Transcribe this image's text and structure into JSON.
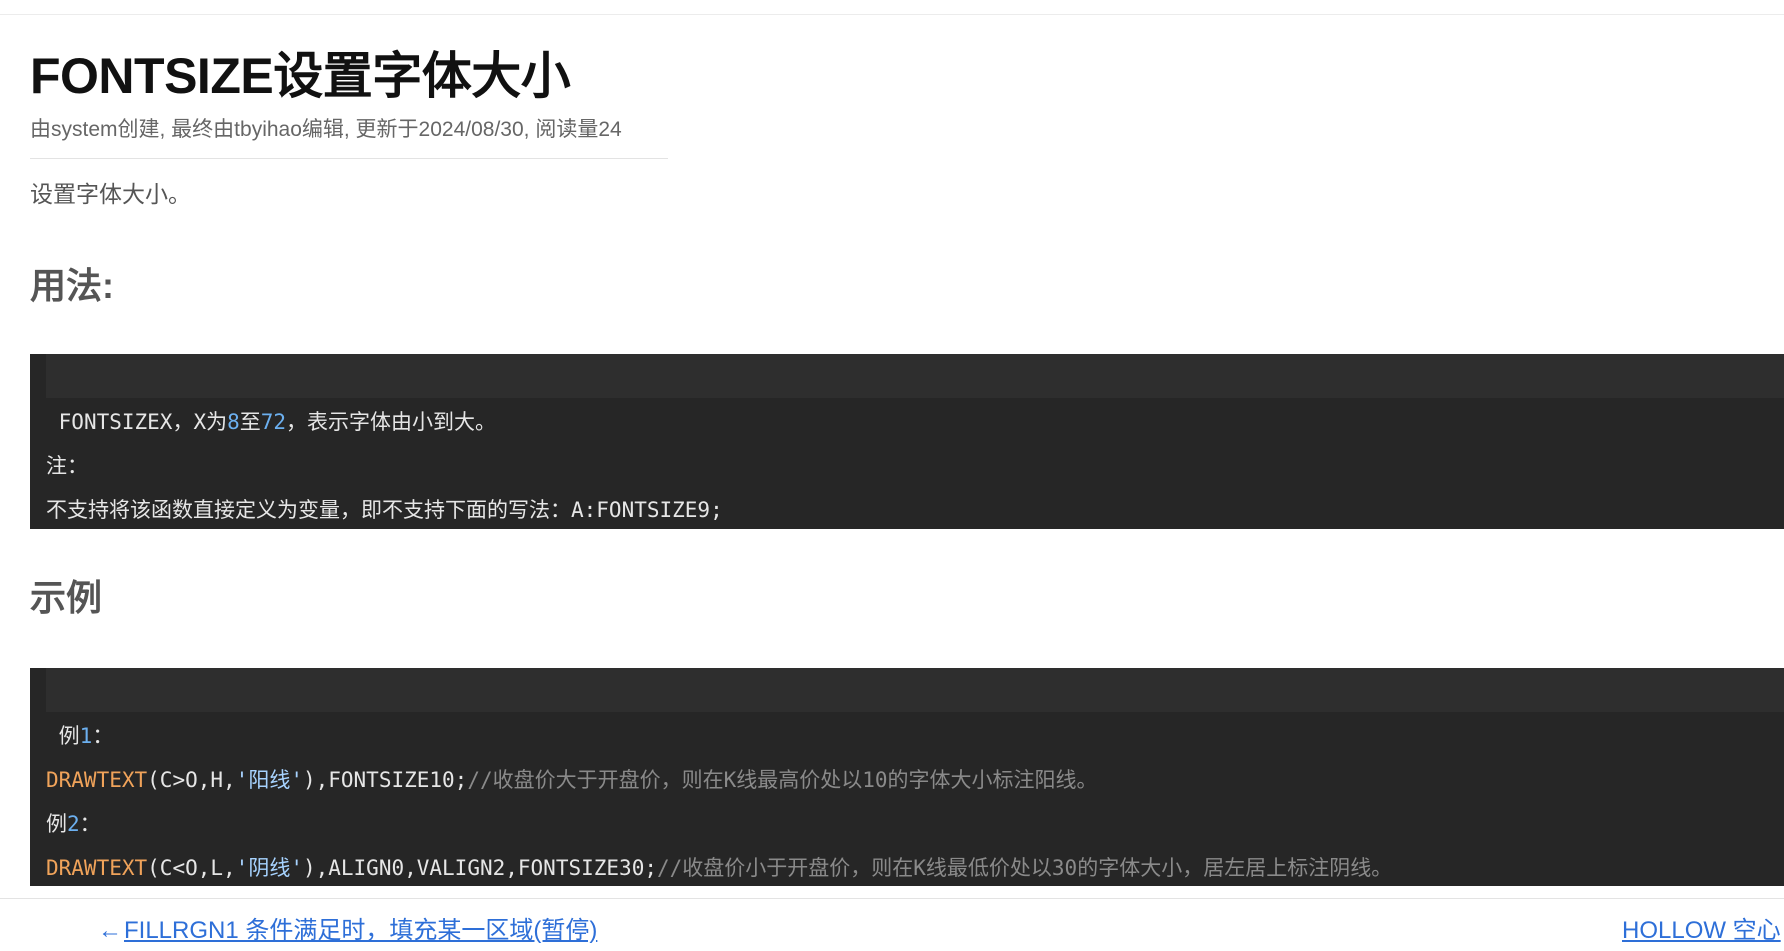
{
  "page": {
    "title": "FONTSIZE设置字体大小",
    "meta": "由system创建, 最终由tbyihao编辑, 更新于2024/08/30, 阅读量24",
    "intro": "设置字体大小。"
  },
  "usage": {
    "heading": "用法:",
    "line1": {
      "a": "FONTSIZEX，X为",
      "n1": "8",
      "b": "至",
      "n2": "72",
      "c": "，表示字体由小到大。"
    },
    "line2": "注：",
    "line3": "不支持将该函数直接定义为变量，即不支持下面的写法：A:FONTSIZE9;"
  },
  "example": {
    "heading": "示例",
    "ex1_label": {
      "a": "例",
      "n": "1",
      "b": "："
    },
    "ex1_code": {
      "fn": "DRAWTEXT",
      "a": "(C>O,H,",
      "str": "'阳线'",
      "b": "),FONTSIZE10;",
      "cmt": "//收盘价大于开盘价，则在K线最高价处以10的字体大小标注阳线。"
    },
    "ex2_label": {
      "a": "例",
      "n": "2",
      "b": "："
    },
    "ex2_code": {
      "fn": "DRAWTEXT",
      "a": "(C<O,L,",
      "str": "'阴线'",
      "b": "),ALIGN0,VALIGN2,FONTSIZE30;",
      "cmt": "//收盘价小于开盘价，则在K线最低价处以30的字体大小，居左居上标注阴线。"
    }
  },
  "nav": {
    "prev_arrow": "←",
    "prev_label": "FILLRGN1 条件满足时，填充某一区域(暂停)",
    "next_label": "HOLLOW 空心"
  },
  "colors": {
    "link": "#2e6fd8",
    "code_bg": "#262626",
    "code_number": "#6cb0f0",
    "code_function": "#f0a35a",
    "code_comment": "#8a8a8a"
  }
}
